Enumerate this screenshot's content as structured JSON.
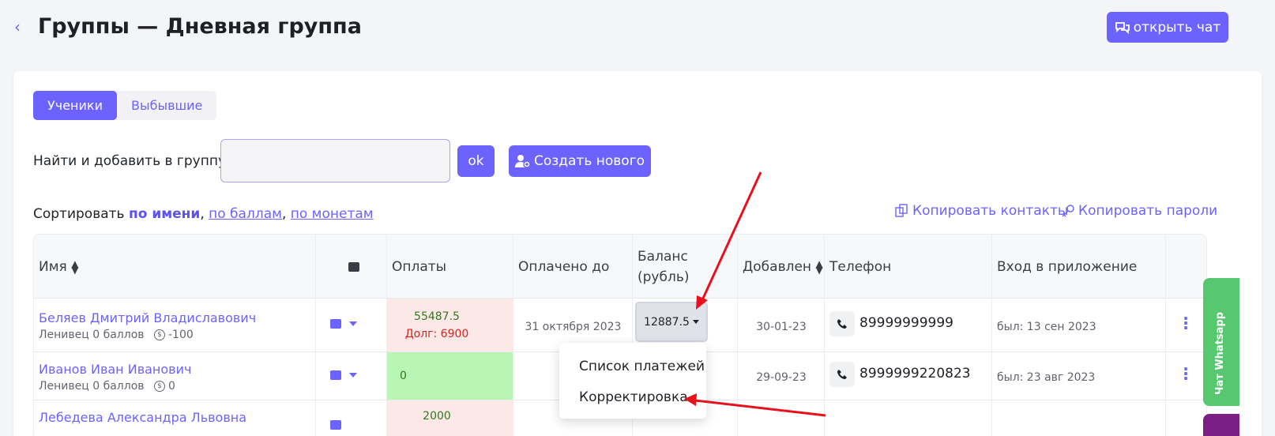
{
  "header": {
    "title": "Группы — Дневная группа",
    "back_icon": "chevron-left-icon",
    "chat_button": "открыть чат"
  },
  "tabs": [
    "Ученики",
    "Выбывшие"
  ],
  "search": {
    "label": "Найти и добавить в группу:",
    "value": "",
    "ok": "ok",
    "create": "Создать нового"
  },
  "sort": {
    "prefix": "Сортировать",
    "by_name": "по имени",
    "by_score": "по баллам",
    "by_coins": "по монетам"
  },
  "copy": {
    "contacts": "Копировать контакты",
    "passwords": "Копировать пароли"
  },
  "table": {
    "columns": [
      "Имя",
      "Оплаты",
      "Оплачено до",
      "Баланс (рубль)",
      "Добавлен",
      "Телефон",
      "Вход в приложение"
    ],
    "rows": [
      {
        "name": "Беляев Дмитрий Владиславович",
        "sub": "Ленивец 0 баллов",
        "coins": "-100",
        "pay1": "55487.5",
        "pay2": "Долг: 6900",
        "paid_to": "31 октября 2023",
        "balance": "12887.5",
        "added": "30-01-23",
        "phone": "89999999999",
        "login": "был: 13 сен 2023"
      },
      {
        "name": "Иванов Иван Иванович",
        "sub": "Ленивец 0 баллов",
        "coins": "0",
        "pay1": "0",
        "added": "29-09-23",
        "phone": "8999999220823",
        "login": "был: 23 авг 2023"
      },
      {
        "name": "Лебедева Александра Львовна",
        "pay1": "2000"
      }
    ]
  },
  "dropdown": {
    "item1": "Список платежей",
    "item2": "Корректировка"
  },
  "side_chat": "Чат Whatsapp",
  "colors": {
    "accent": "#6c63ff",
    "debt_bg": "#fde8e8",
    "paid_bg": "#b9f5b5",
    "whatsapp": "#58c870",
    "arrow": "#e8101a"
  }
}
